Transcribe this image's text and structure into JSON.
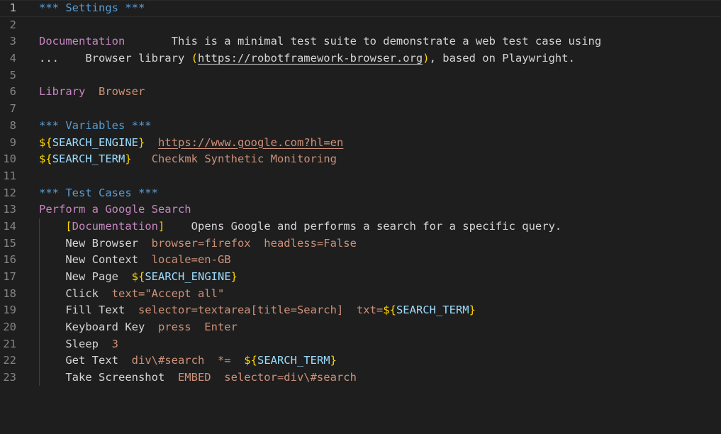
{
  "editor": {
    "active_line": "1",
    "colors": {
      "background": "#1e1e1e",
      "header": "#569cd6",
      "setting": "#c586c0",
      "argument": "#ce9178",
      "variable": "#9cdcfe",
      "brace": "#ffd700",
      "text": "#d4d4d4",
      "line_number": "#858585"
    },
    "lines": [
      {
        "n": "1",
        "tokens": [
          {
            "t": "*** Settings ***",
            "c": "header"
          }
        ]
      },
      {
        "n": "2",
        "tokens": []
      },
      {
        "n": "3",
        "tokens": [
          {
            "t": "Documentation",
            "c": "setting"
          },
          {
            "t": "       This is a minimal test suite to demonstrate a web test case using",
            "c": "text"
          }
        ]
      },
      {
        "n": "4",
        "tokens": [
          {
            "t": "...    Browser library ",
            "c": "text"
          },
          {
            "t": "(",
            "c": "brace"
          },
          {
            "t": "https://robotframework-browser.org",
            "c": "url-plain"
          },
          {
            "t": ")",
            "c": "brace"
          },
          {
            "t": ", based on Playwright.",
            "c": "text"
          }
        ]
      },
      {
        "n": "5",
        "tokens": []
      },
      {
        "n": "6",
        "tokens": [
          {
            "t": "Library",
            "c": "setting"
          },
          {
            "t": "  ",
            "c": "text"
          },
          {
            "t": "Browser",
            "c": "arg"
          }
        ]
      },
      {
        "n": "7",
        "tokens": []
      },
      {
        "n": "8",
        "tokens": [
          {
            "t": "*** Variables ***",
            "c": "header"
          }
        ]
      },
      {
        "n": "9",
        "tokens": [
          {
            "t": "$",
            "c": "brace"
          },
          {
            "t": "{",
            "c": "brace"
          },
          {
            "t": "SEARCH_ENGINE",
            "c": "var"
          },
          {
            "t": "}",
            "c": "brace"
          },
          {
            "t": "  ",
            "c": "text"
          },
          {
            "t": "https://www.google.com?hl=en",
            "c": "url"
          }
        ]
      },
      {
        "n": "10",
        "tokens": [
          {
            "t": "$",
            "c": "brace"
          },
          {
            "t": "{",
            "c": "brace"
          },
          {
            "t": "SEARCH_TERM",
            "c": "var"
          },
          {
            "t": "}",
            "c": "brace"
          },
          {
            "t": "   ",
            "c": "text"
          },
          {
            "t": "Checkmk Synthetic Monitoring",
            "c": "arg"
          }
        ]
      },
      {
        "n": "11",
        "tokens": []
      },
      {
        "n": "12",
        "tokens": [
          {
            "t": "*** Test Cases ***",
            "c": "header"
          }
        ]
      },
      {
        "n": "13",
        "tokens": [
          {
            "t": "Perform a Google Search",
            "c": "testname"
          }
        ]
      },
      {
        "n": "14",
        "tokens": [
          {
            "t": "    ",
            "c": "text"
          },
          {
            "t": "[",
            "c": "bracket"
          },
          {
            "t": "Documentation",
            "c": "setting"
          },
          {
            "t": "]",
            "c": "bracket"
          },
          {
            "t": "    Opens Google and performs a search for a specific query.",
            "c": "text"
          }
        ]
      },
      {
        "n": "15",
        "tokens": [
          {
            "t": "    New Browser  ",
            "c": "kw"
          },
          {
            "t": "browser=firefox  headless=False",
            "c": "arg"
          }
        ]
      },
      {
        "n": "16",
        "tokens": [
          {
            "t": "    New Context  ",
            "c": "kw"
          },
          {
            "t": "locale=en-GB",
            "c": "arg"
          }
        ]
      },
      {
        "n": "17",
        "tokens": [
          {
            "t": "    New Page  ",
            "c": "kw"
          },
          {
            "t": "$",
            "c": "brace"
          },
          {
            "t": "{",
            "c": "brace"
          },
          {
            "t": "SEARCH_ENGINE",
            "c": "var"
          },
          {
            "t": "}",
            "c": "brace"
          }
        ]
      },
      {
        "n": "18",
        "tokens": [
          {
            "t": "    Click  ",
            "c": "kw"
          },
          {
            "t": "text=\"Accept all\"",
            "c": "arg"
          }
        ]
      },
      {
        "n": "19",
        "tokens": [
          {
            "t": "    Fill Text  ",
            "c": "kw"
          },
          {
            "t": "selector=textarea[title=Search]  txt=",
            "c": "arg"
          },
          {
            "t": "$",
            "c": "brace"
          },
          {
            "t": "{",
            "c": "brace"
          },
          {
            "t": "SEARCH_TERM",
            "c": "var"
          },
          {
            "t": "}",
            "c": "brace"
          }
        ]
      },
      {
        "n": "20",
        "tokens": [
          {
            "t": "    Keyboard Key  ",
            "c": "kw"
          },
          {
            "t": "press  Enter",
            "c": "arg"
          }
        ]
      },
      {
        "n": "21",
        "tokens": [
          {
            "t": "    Sleep  ",
            "c": "kw"
          },
          {
            "t": "3",
            "c": "arg"
          }
        ]
      },
      {
        "n": "22",
        "tokens": [
          {
            "t": "    Get Text  ",
            "c": "kw"
          },
          {
            "t": "div\\#search  *=  ",
            "c": "arg"
          },
          {
            "t": "$",
            "c": "brace"
          },
          {
            "t": "{",
            "c": "brace"
          },
          {
            "t": "SEARCH_TERM",
            "c": "var"
          },
          {
            "t": "}",
            "c": "brace"
          }
        ]
      },
      {
        "n": "23",
        "tokens": [
          {
            "t": "    Take Screenshot  ",
            "c": "kw"
          },
          {
            "t": "EMBED  selector=div\\#search",
            "c": "arg"
          }
        ]
      }
    ]
  }
}
